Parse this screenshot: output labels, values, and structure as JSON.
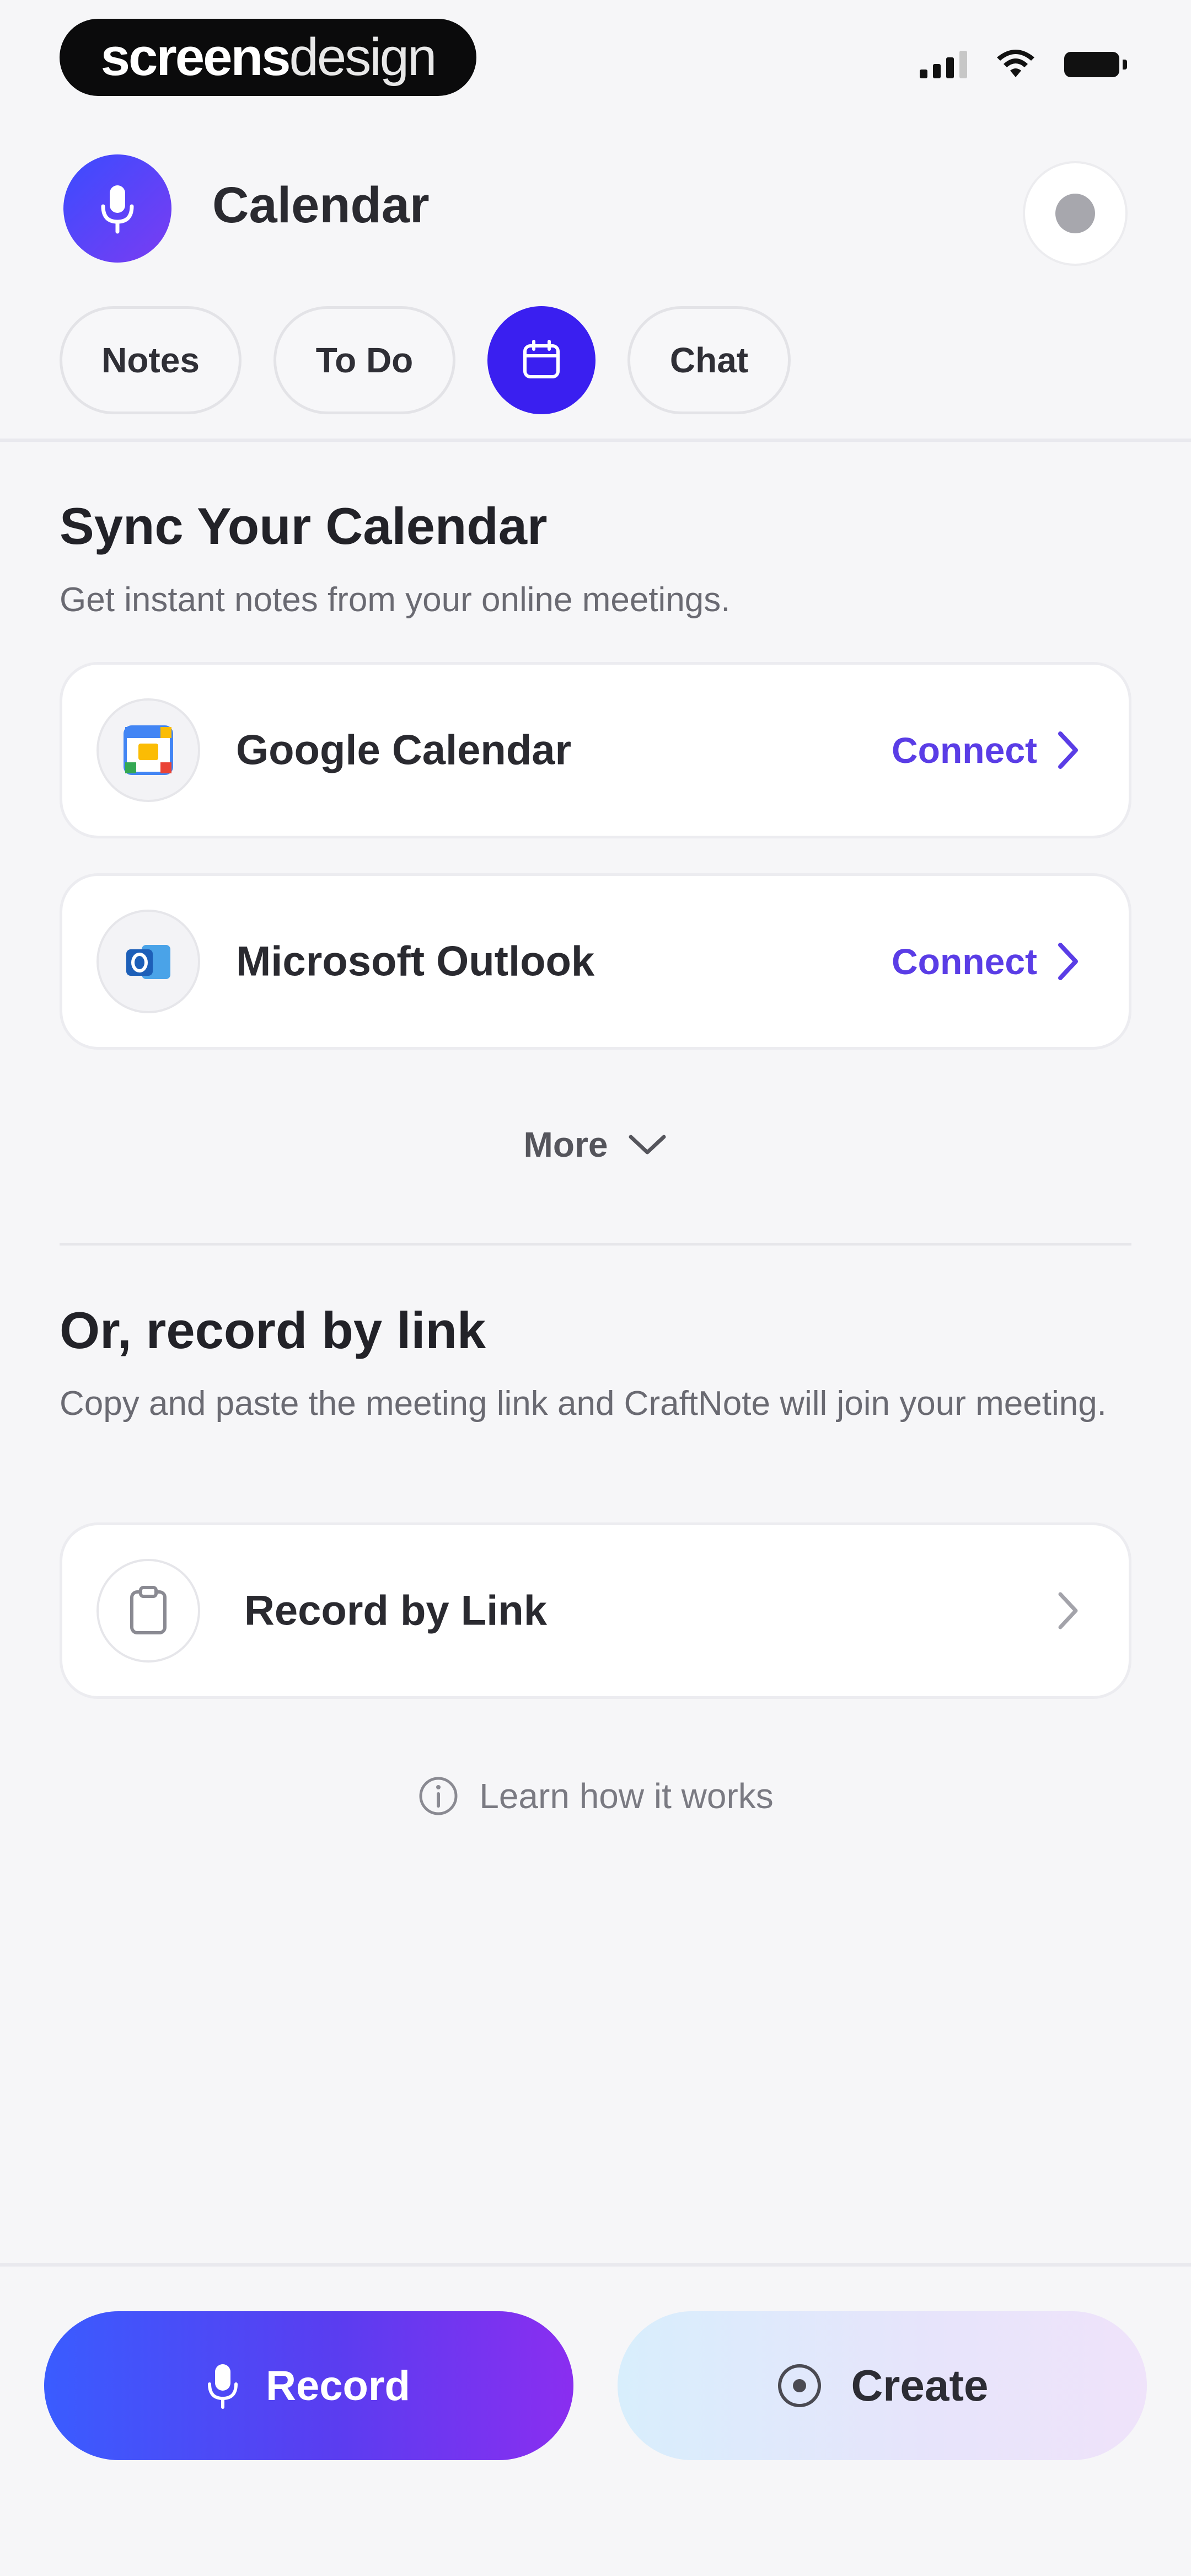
{
  "status_bar": {
    "brand_bold": "screens",
    "brand_light": "design",
    "icons": [
      "signal-icon",
      "wifi-icon",
      "battery-icon"
    ]
  },
  "header": {
    "title": "Calendar",
    "avatar_icon": "microphone-icon",
    "settings_icon": "settings-icon"
  },
  "tabs": [
    {
      "label": "Notes",
      "active": false
    },
    {
      "label": "To Do",
      "active": false
    },
    {
      "label": "",
      "icon": "calendar-icon",
      "active": true
    },
    {
      "label": "Chat",
      "active": false
    }
  ],
  "sync": {
    "title": "Sync Your Calendar",
    "subtitle": "Get instant notes from your online meetings.",
    "providers": [
      {
        "name": "Google Calendar",
        "action": "Connect",
        "icon": "google-calendar-icon"
      },
      {
        "name": "Microsoft Outlook",
        "action": "Connect",
        "icon": "outlook-icon"
      }
    ],
    "more_label": "More"
  },
  "record_link": {
    "title": "Or, record by link",
    "subtitle": "Copy and paste the meeting link and CraftNote will join your meeting.",
    "card_label": "Record by Link",
    "card_icon": "clipboard-icon",
    "learn_label": "Learn how it works"
  },
  "bottom": {
    "record_label": "Record",
    "create_label": "Create"
  },
  "colors": {
    "accent": "#3a1ff0",
    "connect": "#5a3de6",
    "background": "#f6f6f8"
  }
}
